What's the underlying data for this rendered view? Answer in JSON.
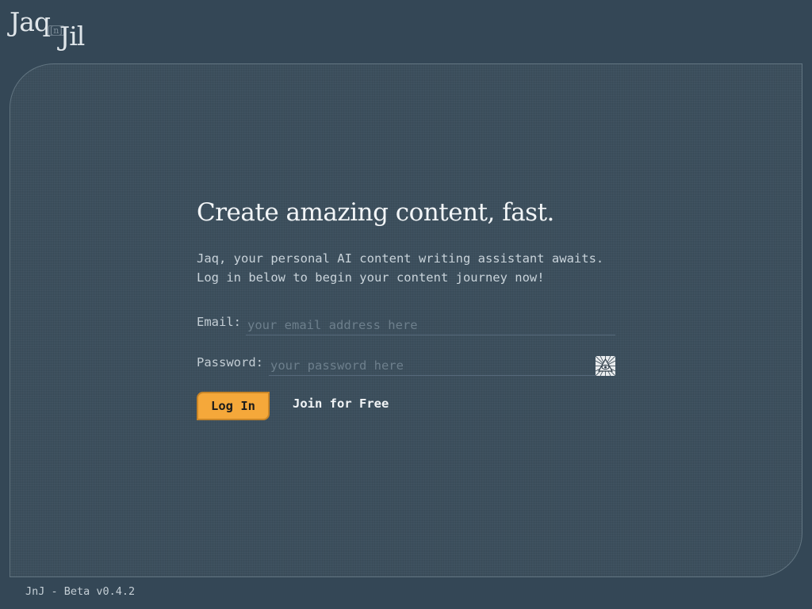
{
  "brand": {
    "logo_left": "Jaq",
    "logo_mid": "[n]",
    "logo_right": "Jil"
  },
  "hero": {
    "headline": "Create amazing content, fast.",
    "intro_line_1": "Jaq, your personal AI content writing assistant awaits.",
    "intro_line_2": "Log in below to begin your content journey now!"
  },
  "form": {
    "email_label": "Email:",
    "email_placeholder": "your email address here",
    "email_value": "",
    "password_label": "Password:",
    "password_placeholder": "your password here",
    "password_value": "",
    "password_toggle_icon": "eye-pyramid-icon",
    "login_label": "Log In",
    "join_label": "Join for Free"
  },
  "footer": {
    "version": "JnJ - Beta v0.4.2"
  },
  "colors": {
    "background": "#344756",
    "panel": "#3c4f5d",
    "accent": "#f5a83a",
    "text": "#d6dde2"
  }
}
